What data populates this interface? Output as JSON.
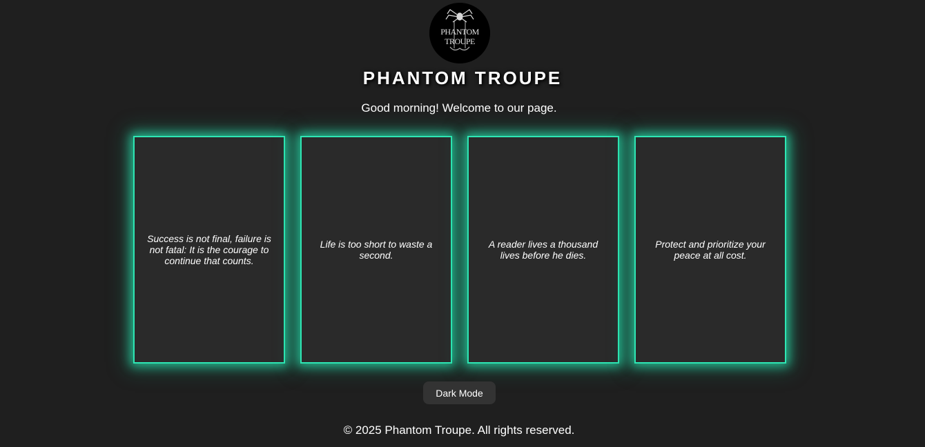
{
  "header": {
    "logo_text": [
      "PHANTOM",
      "TROUPE"
    ],
    "title": "PHANTOM TROUPE",
    "greeting": "Good morning! Welcome to our page."
  },
  "cards": [
    {
      "quote": "Success is not final, failure is not fatal: It is the courage to continue that counts."
    },
    {
      "quote": "Life is too short to waste a second."
    },
    {
      "quote": "A reader lives a thousand lives before he dies."
    },
    {
      "quote": "Protect and prioritize your peace at all cost."
    }
  ],
  "controls": {
    "mode_button_label": "Dark Mode"
  },
  "footer": {
    "text": "© 2025 Phantom Troupe. All rights reserved."
  },
  "colors": {
    "background": "#1f1f1f",
    "card_background": "#2a2a2a",
    "card_glow": "#2ee6b4",
    "button_background": "#333333",
    "text": "#ffffff"
  },
  "icons": {
    "logo": "spider-logo-icon"
  }
}
